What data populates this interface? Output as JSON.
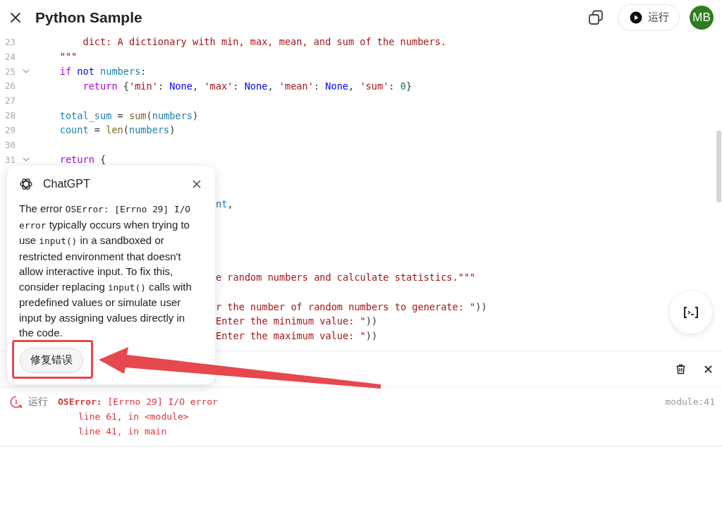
{
  "header": {
    "title": "Python Sample",
    "run_button": "运行",
    "avatar": "MB"
  },
  "editor": {
    "lines": [
      {
        "kind": "full",
        "num": "23",
        "foldable": false,
        "tokens": [
          {
            "kind": "str",
            "text": "        dict: A dictionary with min, max, mean, and sum of the numbers."
          }
        ]
      },
      {
        "kind": "full",
        "num": "24",
        "foldable": false,
        "tokens": [
          {
            "kind": "str",
            "text": "    \"\"\""
          }
        ]
      },
      {
        "kind": "full",
        "num": "25",
        "foldable": true,
        "tokens": [
          {
            "kind": "kw",
            "text": "    if "
          },
          {
            "kind": "kw2",
            "text": "not "
          },
          {
            "kind": "var",
            "text": "numbers"
          },
          {
            "kind": "plain",
            "text": ":"
          }
        ]
      },
      {
        "kind": "full",
        "num": "26",
        "foldable": false,
        "tokens": [
          {
            "kind": "kw",
            "text": "        return"
          },
          {
            "kind": "plain",
            "text": " {"
          },
          {
            "kind": "str",
            "text": "'min'"
          },
          {
            "kind": "plain",
            "text": ": "
          },
          {
            "kind": "kw2",
            "text": "None"
          },
          {
            "kind": "plain",
            "text": ", "
          },
          {
            "kind": "str",
            "text": "'max'"
          },
          {
            "kind": "plain",
            "text": ": "
          },
          {
            "kind": "kw2",
            "text": "None"
          },
          {
            "kind": "plain",
            "text": ", "
          },
          {
            "kind": "str",
            "text": "'mean'"
          },
          {
            "kind": "plain",
            "text": ": "
          },
          {
            "kind": "kw2",
            "text": "None"
          },
          {
            "kind": "plain",
            "text": ", "
          },
          {
            "kind": "str",
            "text": "'sum'"
          },
          {
            "kind": "plain",
            "text": ": "
          },
          {
            "kind": "num",
            "text": "0"
          },
          {
            "kind": "plain",
            "text": "}"
          }
        ]
      },
      {
        "kind": "full",
        "num": "27",
        "foldable": false
      },
      {
        "kind": "full",
        "num": "28",
        "foldable": false,
        "tokens": [
          {
            "kind": "var",
            "text": "    total_sum"
          },
          {
            "kind": "plain",
            "text": " = "
          },
          {
            "kind": "fn",
            "text": "sum"
          },
          {
            "kind": "plain",
            "text": "("
          },
          {
            "kind": "var",
            "text": "numbers"
          },
          {
            "kind": "plain",
            "text": ")"
          }
        ]
      },
      {
        "kind": "full",
        "num": "29",
        "foldable": false,
        "tokens": [
          {
            "kind": "var",
            "text": "    count"
          },
          {
            "kind": "plain",
            "text": " = "
          },
          {
            "kind": "fn",
            "text": "len"
          },
          {
            "kind": "plain",
            "text": "("
          },
          {
            "kind": "var",
            "text": "numbers"
          },
          {
            "kind": "plain",
            "text": ")"
          }
        ]
      },
      {
        "kind": "full",
        "num": "30",
        "foldable": false
      },
      {
        "kind": "full",
        "num": "31",
        "foldable": true,
        "tokens": [
          {
            "kind": "kw",
            "text": "    return"
          },
          {
            "kind": "plain",
            "text": " {"
          }
        ]
      },
      {
        "kind": "hidden"
      },
      {
        "kind": "hidden"
      },
      {
        "kind": "partial",
        "tokens": [
          {
            "kind": "var",
            "text": "nt"
          },
          {
            "kind": "plain",
            "text": ","
          }
        ]
      },
      {
        "kind": "hidden"
      },
      {
        "kind": "hidden"
      },
      {
        "kind": "hidden"
      },
      {
        "kind": "hidden"
      },
      {
        "kind": "partial",
        "tokens": [
          {
            "kind": "str",
            "text": "e random numbers and calculate statistics.\"\"\""
          }
        ]
      },
      {
        "kind": "hidden"
      },
      {
        "kind": "partial",
        "tokens": [
          {
            "kind": "str",
            "text": "r the number of random numbers to generate: \""
          },
          {
            "kind": "plain",
            "text": "))"
          }
        ]
      },
      {
        "kind": "partial",
        "tokens": [
          {
            "kind": "str",
            "text": "Enter the minimum value: \""
          },
          {
            "kind": "plain",
            "text": "))"
          }
        ]
      },
      {
        "kind": "partial",
        "tokens": [
          {
            "kind": "str",
            "text": "Enter the maximum value: \""
          },
          {
            "kind": "plain",
            "text": "))"
          }
        ]
      }
    ]
  },
  "assistant_popup": {
    "title": "ChatGPT",
    "message": [
      {
        "text": "The error ",
        "code": false
      },
      {
        "text": "OSError: [Errno 29] I/O error",
        "code": true
      },
      {
        "text": " typically occurs when trying to use ",
        "code": false
      },
      {
        "text": "input()",
        "code": true
      },
      {
        "text": " in a sandboxed or restricted environment that doesn't allow interactive input. To fix this, consider replacing ",
        "code": false
      },
      {
        "text": "input()",
        "code": true
      },
      {
        "text": " calls with predefined values or simulate user input by assigning values directly in the code.",
        "code": false
      }
    ],
    "fix_button": "修复错误"
  },
  "console": {
    "entries": [
      {
        "source": "运行",
        "error_name": "OSError:",
        "message": "[Errno 29] I/O error",
        "location": "module:41",
        "traceback": [
          "line 61, in <module>",
          "line 41, in main"
        ]
      }
    ]
  }
}
